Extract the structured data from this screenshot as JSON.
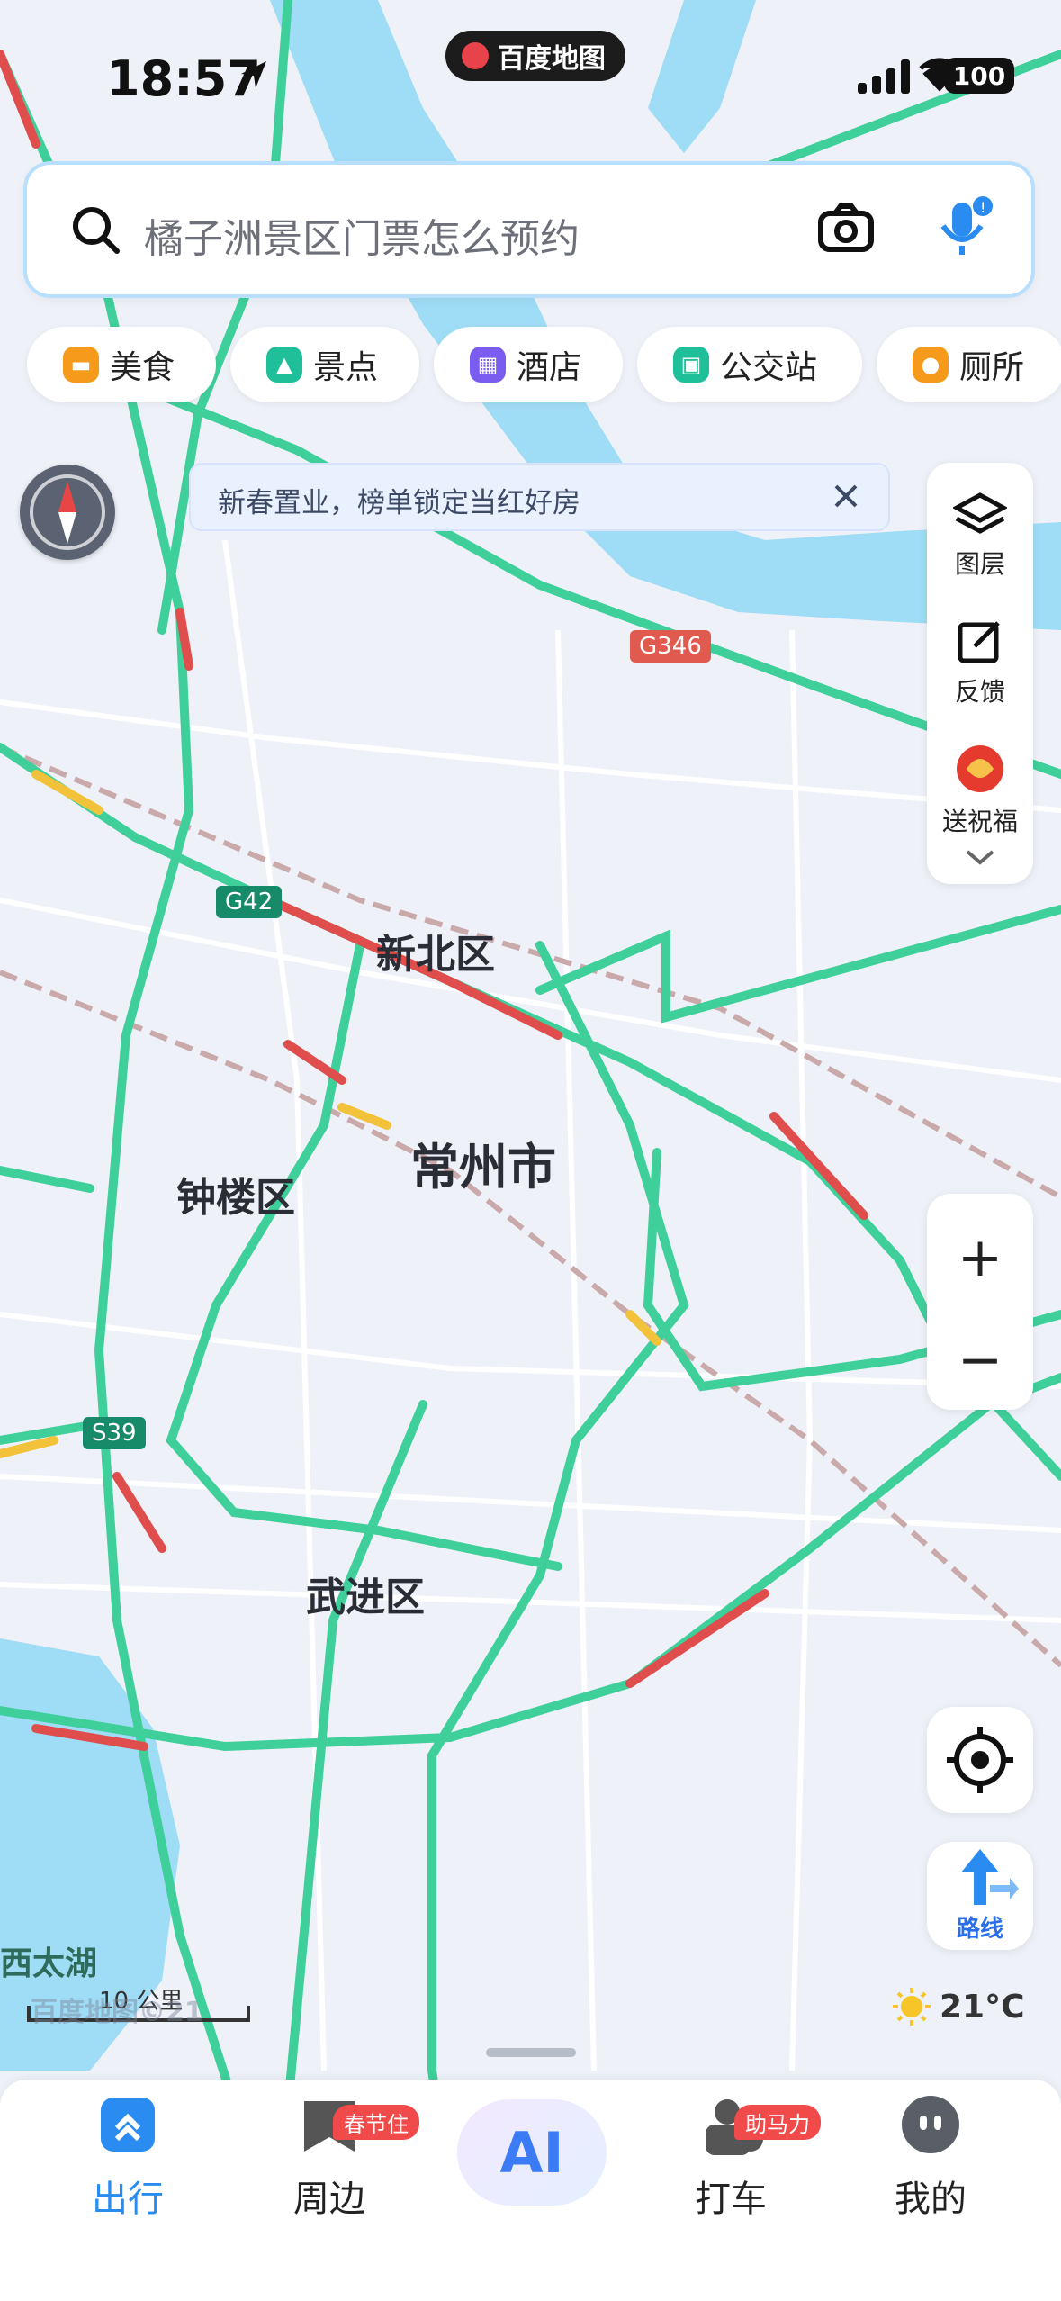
{
  "status_bar": {
    "time": "18:57",
    "brand": "百度地图",
    "battery": "100"
  },
  "search": {
    "placeholder": "橘子洲景区门票怎么预约"
  },
  "categories": [
    {
      "label": "美食",
      "color": "#f59a1b"
    },
    {
      "label": "景点",
      "color": "#1fbf9a"
    },
    {
      "label": "酒店",
      "color": "#7a5cf0"
    },
    {
      "label": "公交站",
      "color": "#1fbf9a"
    },
    {
      "label": "厕所",
      "color": "#f59a1b"
    }
  ],
  "notice": {
    "text": "新春置业，榜单锁定当红好房"
  },
  "right_panel": {
    "layers": "图层",
    "feedback": "反馈",
    "blessing": "送祝福"
  },
  "map": {
    "city": "常州市",
    "districts": [
      "新北区",
      "钟楼区",
      "武进区"
    ],
    "lake": "西太湖",
    "shields": [
      "G346",
      "G42",
      "S39"
    ]
  },
  "scale": {
    "label": "10 公里"
  },
  "watermark": "百度地图©21",
  "weather": {
    "temp": "21°C"
  },
  "route": {
    "label": "路线"
  },
  "tabs": [
    {
      "label": "出行",
      "active": true
    },
    {
      "label": "周边",
      "badge": "春节住"
    },
    {
      "label": "AI"
    },
    {
      "label": "打车",
      "badge": "助马力"
    },
    {
      "label": "我的"
    }
  ]
}
